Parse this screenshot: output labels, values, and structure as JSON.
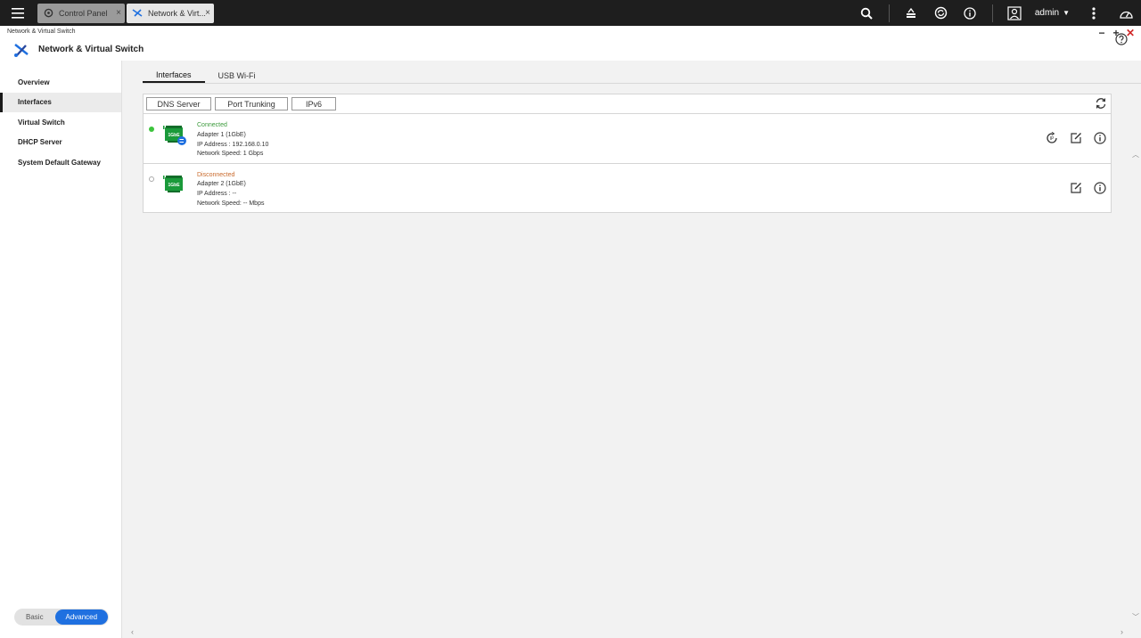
{
  "taskbar": {
    "tabs": [
      {
        "label": "Control Panel",
        "icon": "gear-icon",
        "active": false
      },
      {
        "label": "Network & Virt...",
        "icon": "network-switch-icon",
        "active": true
      }
    ],
    "user": "admin",
    "icons": [
      "search-icon",
      "stack-icon",
      "sync-icon",
      "info-icon",
      "user-icon",
      "more-icon",
      "dashboard-icon"
    ]
  },
  "window": {
    "small_title": "Network & Virtual Switch",
    "title": "Network & Virtual Switch"
  },
  "sidebar": {
    "items": [
      {
        "label": "Overview",
        "active": false
      },
      {
        "label": "Interfaces",
        "active": true
      },
      {
        "label": "Virtual Switch",
        "active": false
      },
      {
        "label": "DHCP Server",
        "active": false
      },
      {
        "label": "System Default Gateway",
        "active": false
      }
    ],
    "mode": {
      "basic": "Basic",
      "advanced": "Advanced",
      "selected": "Advanced"
    }
  },
  "subtabs": [
    {
      "label": "Interfaces",
      "active": true
    },
    {
      "label": "USB Wi-Fi",
      "active": false
    }
  ],
  "toolbar": {
    "buttons": [
      "DNS Server",
      "Port Trunking",
      "IPv6"
    ]
  },
  "adapters": [
    {
      "status": "Connected",
      "name": "Adapter 1 (1GbE)",
      "ip": "IP Address : 192.168.0.10",
      "speed": "Network Speed: 1 Gbps",
      "nic_label": "1GbE"
    },
    {
      "status": "Disconnected",
      "name": "Adapter 2 (1GbE)",
      "ip": "IP Address : --",
      "speed": "Network Speed: -- Mbps",
      "nic_label": "1GbE"
    }
  ],
  "colors": {
    "accent": "#1f70e0",
    "connected": "#3b9a3b",
    "disconnected": "#c96a2c",
    "nic_green": "#1a9a3a"
  }
}
